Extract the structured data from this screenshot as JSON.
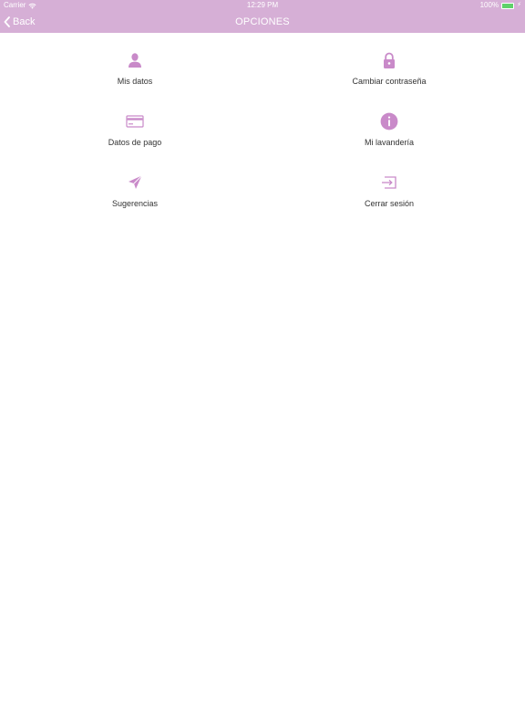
{
  "status_bar": {
    "carrier": "Carrier",
    "time": "12:29 PM",
    "battery": "100%",
    "battery_level": 1.0
  },
  "nav": {
    "back_label": "Back",
    "title": "OPCIONES"
  },
  "colors": {
    "accent": "#d6afd6",
    "icon": "#c98ac9",
    "text": "#333333"
  },
  "options": [
    {
      "label": "Mis datos",
      "icon": "user-icon"
    },
    {
      "label": "Cambiar contraseña",
      "icon": "lock-icon"
    },
    {
      "label": "Datos de pago",
      "icon": "credit-card-icon"
    },
    {
      "label": "Mi lavandería",
      "icon": "info-icon"
    },
    {
      "label": "Sugerencias",
      "icon": "paper-plane-icon"
    },
    {
      "label": "Cerrar sesión",
      "icon": "logout-icon"
    }
  ]
}
